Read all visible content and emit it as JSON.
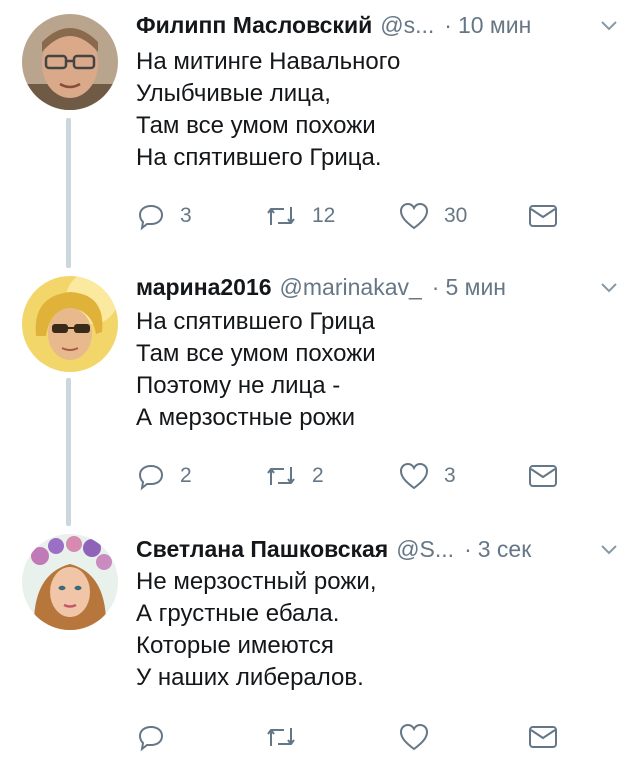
{
  "tweets": [
    {
      "name": "Филипп Масловский",
      "handle": "@s...",
      "time": "10 мин",
      "lines": [
        "На митинге Навального",
        "Улыбчивые лица,",
        "Там все умом похожи",
        "На спятившего Грица."
      ],
      "replies": "3",
      "retweets": "12",
      "likes": "30"
    },
    {
      "name": "марина2016",
      "handle": "@marinakav_",
      "time": "5 мин",
      "lines": [
        "На спятившего Грица",
        "Там все умом похожи",
        "Поэтому не лица -",
        "А мерзостные рожи"
      ],
      "replies": "2",
      "retweets": "2",
      "likes": "3"
    },
    {
      "name": "Светлана Пашковская",
      "handle": "@S...",
      "time": "3 сек",
      "lines": [
        "Не мерзостный рожи,",
        "А грустные ебала.",
        "Которые имеются",
        "У наших либералов."
      ],
      "replies": "",
      "retweets": "",
      "likes": ""
    }
  ],
  "separator": "·",
  "icons": [
    "reply-icon",
    "retweet-icon",
    "like-icon",
    "direct-message-icon",
    "caret-down-icon"
  ],
  "colors": {
    "text": "#14171a",
    "secondary": "#657786",
    "thread_line": "#ccd6dd"
  }
}
